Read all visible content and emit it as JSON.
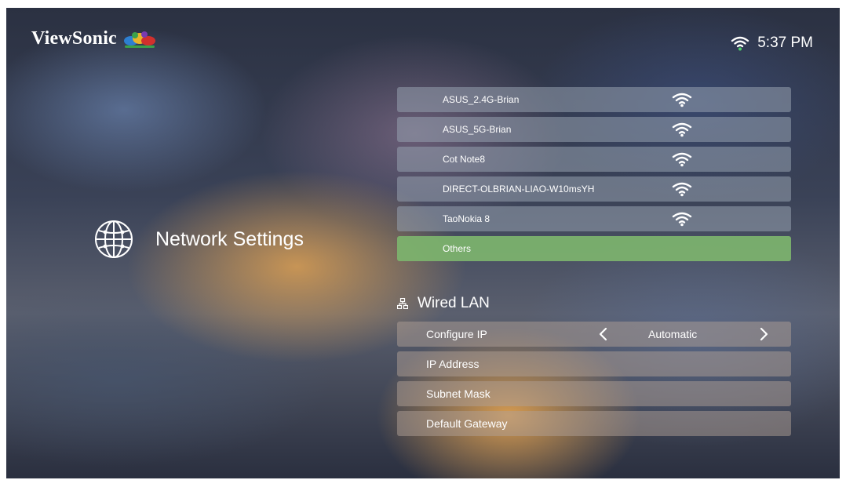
{
  "header": {
    "logo_text": "ViewSonic",
    "clock": "5:37 PM",
    "status_icon": "wifi-icon"
  },
  "section": {
    "title": "Network Settings",
    "icon": "globe-icon"
  },
  "wifi_networks": [
    {
      "name": "ASUS_2.4G-Brian",
      "signal_icon": "wifi-signal-icon"
    },
    {
      "name": "ASUS_5G-Brian",
      "signal_icon": "wifi-signal-icon"
    },
    {
      "name": "Cot Note8",
      "signal_icon": "wifi-signal-icon"
    },
    {
      "name": "DIRECT-OLBRIAN-LIAO-W10msYH",
      "signal_icon": "wifi-signal-icon"
    },
    {
      "name": "TaoNokia 8",
      "signal_icon": "wifi-signal-icon"
    },
    {
      "name": "Others",
      "selected": true
    }
  ],
  "wired_lan": {
    "title": "Wired LAN",
    "icon": "network-icon",
    "rows": [
      {
        "label": "Configure IP",
        "value": "Automatic"
      },
      {
        "label": "IP Address"
      },
      {
        "label": "Subnet Mask"
      },
      {
        "label": "Default Gateway"
      }
    ]
  },
  "colors": {
    "selected_row": "#7db46e",
    "row": "#96a0af",
    "text": "#ffffff"
  }
}
